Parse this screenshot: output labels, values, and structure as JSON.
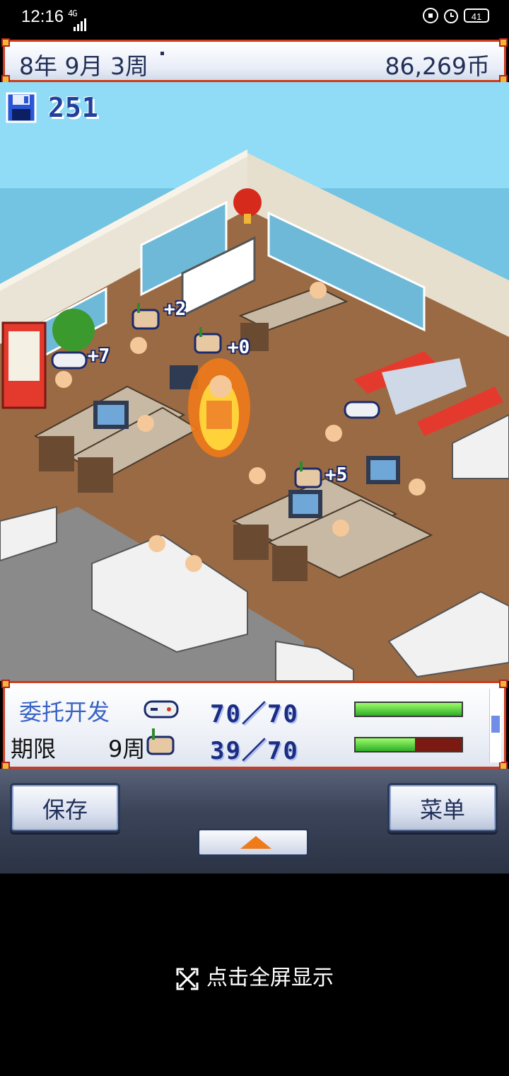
{
  "status_bar": {
    "time": "12:16",
    "network": "4G",
    "battery": "41"
  },
  "header": {
    "date": "8年 9月 3周",
    "money": "86,269币"
  },
  "scene": {
    "save_count": "251",
    "bubbles": [
      "+2",
      "+7",
      "+0",
      "+5"
    ]
  },
  "info_panel": {
    "title": "委托开发",
    "deadline_label": "期限",
    "deadline_value": "9周",
    "stat1": {
      "icon": "gamepad-icon",
      "value": "70／70",
      "fill_fraction": 1.0
    },
    "stat2": {
      "icon": "paint-palette-icon",
      "value": "39／70",
      "fill_fraction": 0.557
    }
  },
  "controls": {
    "save_label": "保存",
    "menu_label": "菜单",
    "expand_icon": "triangle-up-icon"
  },
  "fullscreen": {
    "hint": "点击全屏显示",
    "icon": "fullscreen-icon"
  },
  "colors": {
    "frame_red": "#d03a1c",
    "text_blue": "#223058",
    "bar_green": "#2fae26"
  }
}
